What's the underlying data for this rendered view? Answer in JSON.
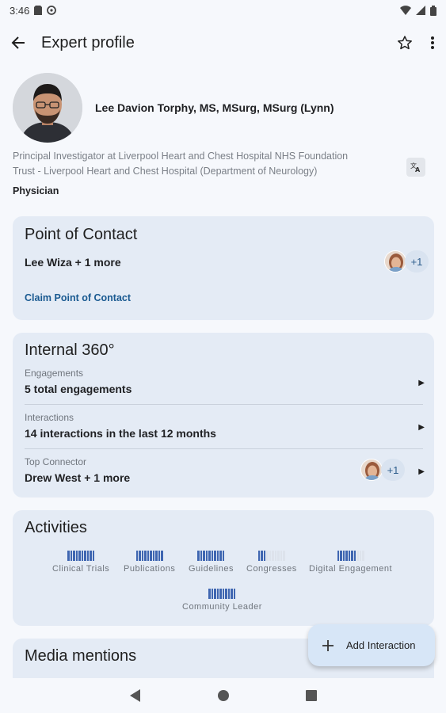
{
  "status_bar": {
    "time": "3:46"
  },
  "app_bar": {
    "title": "Expert profile"
  },
  "profile": {
    "name": "Lee Davion Torphy, MS, MSurg, MSurg (Lynn)",
    "description_line1": "Principal Investigator at Liverpool Heart and Chest Hospital NHS Foundation",
    "description_line2": "Trust - Liverpool Heart and Chest Hospital (Department of Neurology)",
    "role": "Physician"
  },
  "point_of_contact": {
    "title": "Point of Contact",
    "contact_text": "Lee Wiza + 1 more",
    "extra_count": "+1",
    "claim_label": "Claim Point of Contact"
  },
  "internal_360": {
    "title": "Internal 360°",
    "rows": [
      {
        "label": "Engagements",
        "value": "5 total engagements"
      },
      {
        "label": "Interactions",
        "value": "14 interactions in the last 12 months"
      },
      {
        "label": "Top Connector",
        "value": "Drew West + 1 more",
        "extra_count": "+1"
      }
    ]
  },
  "activities": {
    "title": "Activities",
    "items": [
      {
        "label": "Clinical Trials",
        "level": 1.0
      },
      {
        "label": "Publications",
        "level": 1.0
      },
      {
        "label": "Guidelines",
        "level": 1.0
      },
      {
        "label": "Congresses",
        "level": 0.3
      },
      {
        "label": "Digital Engagement",
        "level": 0.7
      },
      {
        "label": "Community Leader",
        "level": 1.0
      }
    ]
  },
  "media_mentions": {
    "title": "Media mentions"
  },
  "fab": {
    "label": "Add Interaction"
  }
}
